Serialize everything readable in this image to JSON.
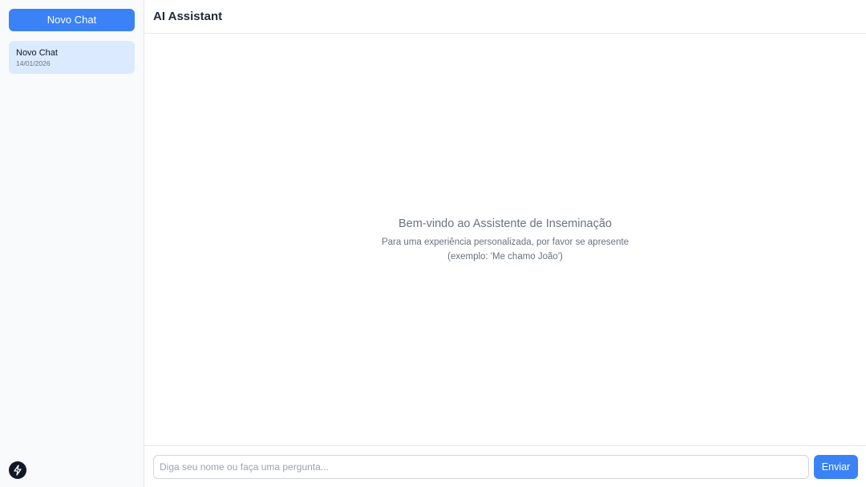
{
  "sidebar": {
    "new_chat_label": "Novo Chat",
    "chats": [
      {
        "title": "Novo Chat",
        "date": "14/01/2026",
        "active": true
      }
    ],
    "badge_icon": "lightning-bolt-icon"
  },
  "header": {
    "title": "AI Assistant"
  },
  "welcome": {
    "title": "Bem-vindo ao Assistente de Inseminação",
    "subtitle": "Para uma experiência personalizada, por favor se apresente",
    "example": "(exemplo: 'Me chamo João')"
  },
  "composer": {
    "placeholder": "Diga seu nome ou faça uma pergunta...",
    "value": "",
    "send_label": "Enviar"
  },
  "colors": {
    "accent": "#3b82f6",
    "active_chat_bg": "#dbeafe",
    "sidebar_bg": "#f9fafb",
    "muted_text": "#6b7280"
  }
}
